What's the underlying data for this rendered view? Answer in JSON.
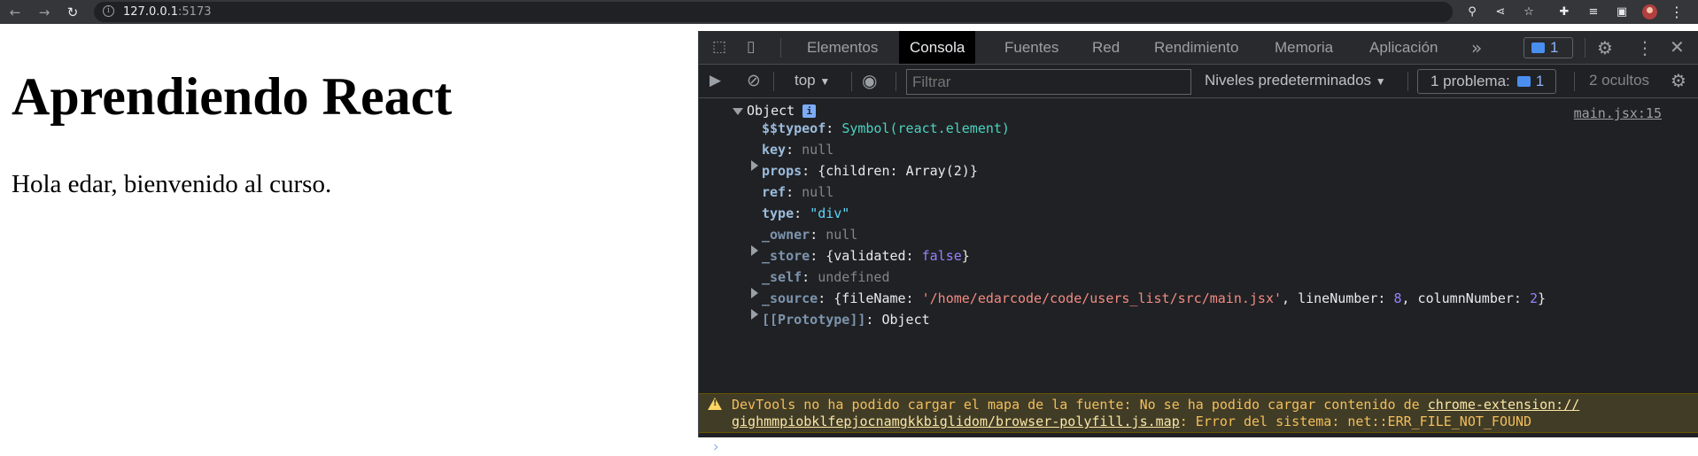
{
  "browser": {
    "url_host": "127.0.0.1",
    "url_port": ":5173",
    "nav_icons": [
      "back-icon",
      "forward-icon",
      "reload-icon"
    ],
    "toolbar_icons": [
      "zoom-icon",
      "share-icon",
      "bookmark-star-icon",
      "extensions-icon",
      "media-queue-icon",
      "side-panel-icon",
      "profile-avatar",
      "menu-icon"
    ]
  },
  "page": {
    "heading": "Aprendiendo React",
    "paragraph": "Hola edar, bienvenido al curso."
  },
  "devtools": {
    "tabs": [
      "Elementos",
      "Consola",
      "Fuentes",
      "Red",
      "Rendimiento",
      "Memoria",
      "Aplicación"
    ],
    "active_tab": "Consola",
    "issues_badge_count": "1",
    "filter_placeholder": "Filtrar",
    "context": "top",
    "levels": "Niveles predeterminados",
    "problems_label": "1 problema:",
    "problems_count": "1",
    "hidden": "2 ocultos"
  },
  "console": {
    "source_link": "main.jsx:15",
    "object_label": "Object",
    "lines": {
      "typeof_key": "$$typeof",
      "typeof_val": "Symbol(react.element)",
      "key_key": "key",
      "key_val": "null",
      "props_key": "props",
      "props_val_pre": "{children: ",
      "props_val_arr": "Array(2)",
      "props_val_post": "}",
      "ref_key": "ref",
      "ref_val": "null",
      "type_key": "type",
      "type_val": "\"div\"",
      "owner_key": "_owner",
      "owner_val": "null",
      "store_key": "_store",
      "store_val_pre": "{validated: ",
      "store_val_bool": "false",
      "store_val_post": "}",
      "self_key": "_self",
      "self_val": "undefined",
      "source_key": "_source",
      "source_val_pre": "{fileName: ",
      "source_val_file": "'/home/edarcode/code/users_list/src/main.jsx'",
      "source_val_mid1": ", lineNumber: ",
      "source_val_line": "8",
      "source_val_mid2": ", columnNumber: ",
      "source_val_col": "2",
      "source_val_post": "}",
      "proto_key": "[[Prototype]]",
      "proto_val": "Object"
    },
    "warning": {
      "text1": "DevTools no ha podido cargar el mapa de la fuente: No se ha podido cargar contenido de ",
      "link1": "chrome-extension://",
      "link2": "gighmmpiobklfepjocnamgkkbiglidom/browser-polyfill.js.map",
      "text2": ": Error del sistema: net::ERR_FILE_NOT_FOUND"
    },
    "prompt": "›"
  }
}
